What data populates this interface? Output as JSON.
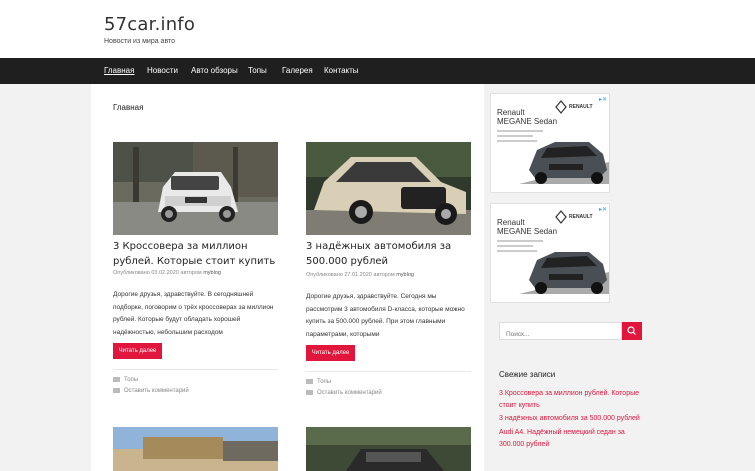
{
  "site": {
    "title": "57car.info",
    "tagline": "Новости из мира авто"
  },
  "nav": [
    {
      "label": "Главная"
    },
    {
      "label": "Новости"
    },
    {
      "label": "Авто обзоры"
    },
    {
      "label": "Топы"
    },
    {
      "label": "Галерея"
    },
    {
      "label": "Контакты"
    }
  ],
  "page": {
    "heading": "Главная"
  },
  "posts": [
    {
      "title": "3 Кроссовера за миллион рублей. Которые стоит купить",
      "meta_prefix": "Опубликовано",
      "date": "03.02.2020",
      "author_prefix": "автором",
      "author": "myblog",
      "excerpt": "Дорогие друзья, здравствуйте. В сегодняшней подборке, поговорим о трёх кроссоверах за миллион рублей. Которые будут обладать хорошей надёжностью, небольшим расходом",
      "button": "Читать далее",
      "category": "Топы",
      "comment": "Оставить комментарий"
    },
    {
      "title": "3 надёжных автомобиля за 500.000 рублей",
      "meta_prefix": "Опубликовано",
      "date": "27.01.2020",
      "author_prefix": "автором",
      "author": "myblog",
      "excerpt": "Дорогие друзья, здравствуйте. Сегодня мы рассмотрим 3 автомобиля D-класса, которые можно купить за 500.000 рублей. При этом главными параметрами, которыми",
      "button": "Читать далее",
      "category": "Топы",
      "comment": "Оставить комментарий"
    }
  ],
  "ads": [
    {
      "brand_line1": "Renault",
      "brand_line2": "MEGANE Sedan",
      "logo_text": "RENAULT"
    },
    {
      "brand_line1": "Renault",
      "brand_line2": "MEGANE Sedan",
      "logo_text": "RENAULT"
    }
  ],
  "search": {
    "placeholder": "Поиск..."
  },
  "recent": {
    "title": "Свежие записи",
    "items": [
      "3 Кроссовера за миллион рублей. Которые стоит купить",
      "3 надёжных автомобиля за 500.000 рублей",
      "Audi A4. Надёжный немецкий седан за 300.000 рублей"
    ]
  },
  "colors": {
    "accent": "#e0163d",
    "nav_bg": "#1f1f1f"
  }
}
